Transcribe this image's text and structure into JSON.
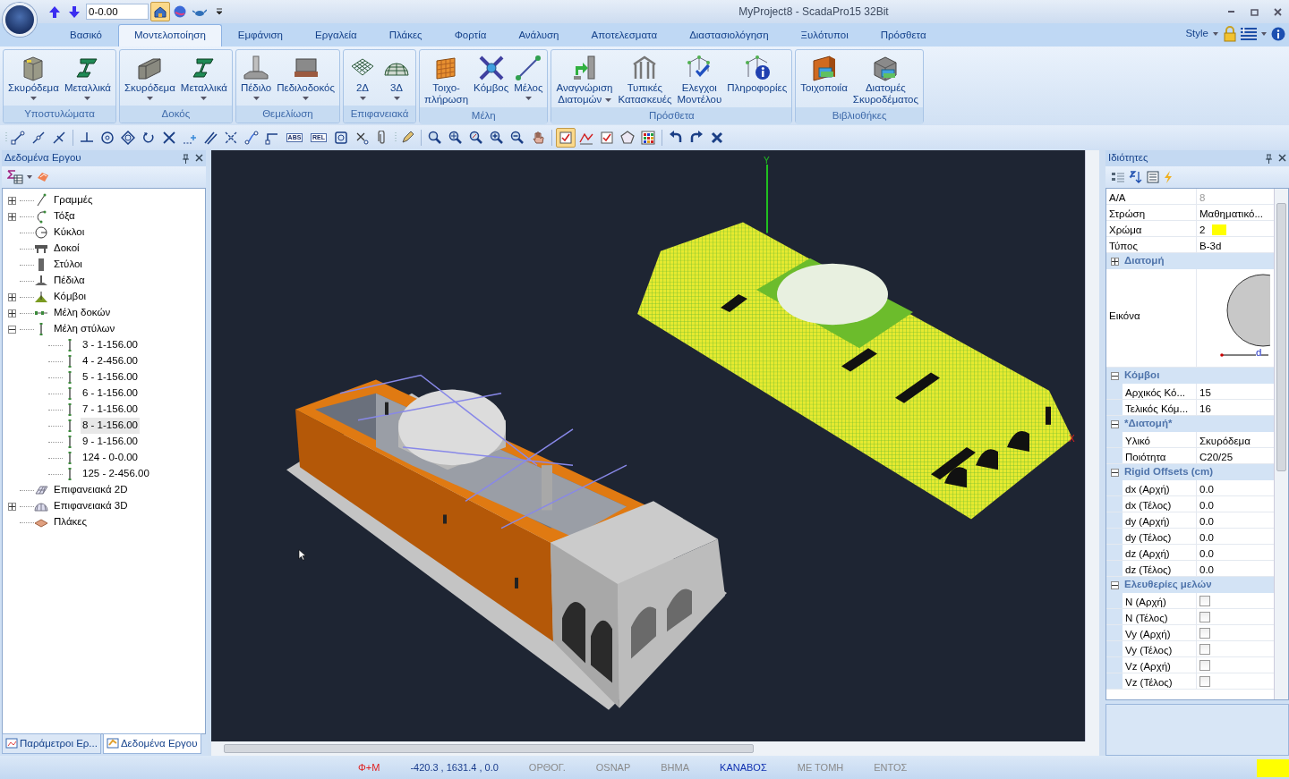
{
  "title_bar": {
    "title": "MyProject8 - ScadaPro15 32Bit",
    "level_value": "0-0.00",
    "quick_tools": [
      {
        "kind": "arrow-up",
        "pressed": false
      },
      {
        "kind": "arrow-down",
        "pressed": false
      },
      {
        "kind": "level"
      },
      {
        "kind": "house",
        "pressed": true
      },
      {
        "kind": "globe",
        "pressed": false
      },
      {
        "kind": "teapot",
        "pressed": false
      }
    ]
  },
  "ribbon": {
    "tabs": [
      {
        "label": "Βασικό",
        "selected": false
      },
      {
        "label": "Μοντελοποίηση",
        "selected": true
      },
      {
        "label": "Εμφάνιση",
        "selected": false
      },
      {
        "label": "Εργαλεία",
        "selected": false
      },
      {
        "label": "Πλάκες",
        "selected": false
      },
      {
        "label": "Φορτία",
        "selected": false
      },
      {
        "label": "Ανάλυση",
        "selected": false
      },
      {
        "label": "Αποτελεσματα",
        "selected": false
      },
      {
        "label": "Διαστασιολόγηση",
        "selected": false
      },
      {
        "label": "Ξυλότυποι",
        "selected": false
      },
      {
        "label": "Πρόσθετα",
        "selected": false
      }
    ],
    "style_label": "Style",
    "groups": [
      {
        "label": "Υποστυλώματα",
        "buttons": [
          {
            "kind": "concrete-column",
            "lines": [
              "Σκυρόδεμα"
            ],
            "dropdown": true
          },
          {
            "kind": "steel-section",
            "lines": [
              "Μεταλλικά"
            ],
            "dropdown": true
          }
        ]
      },
      {
        "label": "Δοκός",
        "buttons": [
          {
            "kind": "concrete-beam",
            "lines": [
              "Σκυρόδεμα"
            ],
            "dropdown": true
          },
          {
            "kind": "steel-section",
            "lines": [
              "Μεταλλικά"
            ],
            "dropdown": true
          }
        ]
      },
      {
        "label": "Θεμελίωση",
        "buttons": [
          {
            "kind": "footing",
            "lines": [
              "Πέδιλο"
            ],
            "dropdown": true
          },
          {
            "kind": "strip-footing",
            "lines": [
              "Πεδιλοδοκός"
            ],
            "dropdown": true
          }
        ]
      },
      {
        "label": "Επιφανειακά",
        "buttons": [
          {
            "kind": "mesh-2d",
            "lines": [
              "2Δ"
            ],
            "dropdown": true
          },
          {
            "kind": "mesh-3d",
            "lines": [
              "3Δ"
            ],
            "dropdown": true
          }
        ]
      },
      {
        "label": "Μέλη",
        "buttons": [
          {
            "kind": "infill-wall",
            "lines": [
              "Τοιχο-",
              "πλήρωση"
            ],
            "dropdown": false
          },
          {
            "kind": "node",
            "lines": [
              "Κόμβος"
            ],
            "dropdown": false
          },
          {
            "kind": "member",
            "lines": [
              "Μέλος"
            ],
            "dropdown": true
          }
        ]
      },
      {
        "label": "Πρόσθετα",
        "buttons": [
          {
            "kind": "section-detect",
            "lines": [
              "Αναγνώριση",
              "Διατομών"
            ],
            "dropdown": true
          },
          {
            "kind": "frame",
            "lines": [
              "Τυπικές",
              "Κατασκευές"
            ],
            "dropdown": false
          },
          {
            "kind": "model-check",
            "lines": [
              "Ελεγχοι",
              "Μοντέλου"
            ],
            "dropdown": false
          },
          {
            "kind": "model-info",
            "lines": [
              "Πληροφορίες"
            ],
            "dropdown": false
          }
        ]
      },
      {
        "label": "Βιβλιοθήκες",
        "buttons": [
          {
            "kind": "masonry",
            "lines": [
              "Τοιχοποιία"
            ],
            "dropdown": false
          },
          {
            "kind": "section-library",
            "lines": [
              "Διατομές",
              "Σκυροδέματος"
            ],
            "dropdown": false
          }
        ]
      }
    ]
  },
  "toolbar": [
    {
      "kind": "grip"
    },
    {
      "kind": "line2"
    },
    {
      "kind": "line1"
    },
    {
      "kind": "line3"
    },
    {
      "kind": "sep"
    },
    {
      "kind": "perp"
    },
    {
      "kind": "target"
    },
    {
      "kind": "diamond"
    },
    {
      "kind": "rotate"
    },
    {
      "kind": "cross"
    },
    {
      "kind": "dashplus"
    },
    {
      "kind": "parallel"
    },
    {
      "kind": "crossdots"
    },
    {
      "kind": "elbow"
    },
    {
      "kind": "corner"
    },
    {
      "kind": "text",
      "text": "ABS",
      "pressed": false
    },
    {
      "kind": "text",
      "text": "REL",
      "pressed": false
    },
    {
      "kind": "square"
    },
    {
      "kind": "xsmall"
    },
    {
      "kind": "clip"
    },
    {
      "kind": "grip"
    },
    {
      "kind": "pencil"
    },
    {
      "kind": "sep"
    },
    {
      "kind": "zoom"
    },
    {
      "kind": "zoomall"
    },
    {
      "kind": "zoomprev"
    },
    {
      "kind": "zoomin"
    },
    {
      "kind": "zoomout"
    },
    {
      "kind": "pan"
    },
    {
      "kind": "sep"
    },
    {
      "kind": "checkbox",
      "pressed": true
    },
    {
      "kind": "checkline",
      "pressed": false
    },
    {
      "kind": "checkbox",
      "pressed": false
    },
    {
      "kind": "pentagon",
      "pressed": false
    },
    {
      "kind": "colorgrid",
      "pressed": false
    },
    {
      "kind": "sep"
    },
    {
      "kind": "undo"
    },
    {
      "kind": "redo"
    },
    {
      "kind": "delete"
    }
  ],
  "project_panel": {
    "title": "Δεδομένα Εργου",
    "tree": [
      {
        "label": "Γραμμές",
        "kind": "line",
        "expandable": true,
        "expanded": false,
        "selected": false
      },
      {
        "label": "Τόξα",
        "kind": "arc",
        "expandable": true,
        "expanded": false,
        "selected": false
      },
      {
        "label": "Κύκλοι",
        "kind": "circle",
        "expandable": false,
        "selected": false
      },
      {
        "label": "Δοκοί",
        "kind": "beam",
        "expandable": false,
        "selected": false
      },
      {
        "label": "Στύλοι",
        "kind": "column",
        "expandable": false,
        "selected": false
      },
      {
        "label": "Πέδιλα",
        "kind": "footing",
        "expandable": false,
        "selected": false
      },
      {
        "label": "Κόμβοι",
        "kind": "node",
        "expandable": true,
        "expanded": false,
        "selected": false
      },
      {
        "label": "Μέλη δοκών",
        "kind": "beam-member",
        "expandable": true,
        "expanded": false,
        "selected": false
      },
      {
        "label": "Μέλη στύλων",
        "kind": "column-member",
        "expandable": true,
        "expanded": true,
        "selected": false,
        "children": [
          {
            "label": "3 - 1-156.00",
            "kind": "column-member",
            "expandable": false,
            "selected": false
          },
          {
            "label": "4 - 2-456.00",
            "kind": "column-member",
            "expandable": false,
            "selected": false
          },
          {
            "label": "5 - 1-156.00",
            "kind": "column-member",
            "expandable": false,
            "selected": false
          },
          {
            "label": "6 - 1-156.00",
            "kind": "column-member",
            "expandable": false,
            "selected": false
          },
          {
            "label": "7 - 1-156.00",
            "kind": "column-member",
            "expandable": false,
            "selected": false
          },
          {
            "label": "8 - 1-156.00",
            "kind": "column-member",
            "expandable": false,
            "selected": true
          },
          {
            "label": "9 - 1-156.00",
            "kind": "column-member",
            "expandable": false,
            "selected": false
          },
          {
            "label": "124 - 0-0.00",
            "kind": "column-member",
            "expandable": false,
            "selected": false
          },
          {
            "label": "125 - 2-456.00",
            "kind": "column-member",
            "expandable": false,
            "selected": false
          }
        ]
      },
      {
        "label": "Επιφανειακά 2D",
        "kind": "surface2d",
        "expandable": false,
        "selected": false
      },
      {
        "label": "Επιφανειακά 3D",
        "kind": "surface3d",
        "expandable": true,
        "expanded": false,
        "selected": false
      },
      {
        "label": "Πλάκες",
        "kind": "slab",
        "expandable": false,
        "selected": false
      }
    ],
    "bottom_tabs": [
      {
        "label": "Παράμετροι Ερ...",
        "selected": false
      },
      {
        "label": "Δεδομένα Εργου",
        "selected": true
      }
    ]
  },
  "viewport": {
    "axis_labels": [
      "Y",
      "X"
    ]
  },
  "properties_panel": {
    "title": "Ιδιότητες",
    "items": [
      {
        "kind": "row",
        "label": "A/A",
        "value": "8",
        "readonly": true
      },
      {
        "kind": "row",
        "label": "Στρώση",
        "value": "Μαθηματικό...",
        "readonly": false
      },
      {
        "kind": "color",
        "label": "Χρώμα",
        "value": "2",
        "color": "#ffff00"
      },
      {
        "kind": "row",
        "label": "Τύπος",
        "value": "B-3d",
        "readonly": false
      },
      {
        "kind": "category",
        "label": "Διατομή",
        "expanded": false
      },
      {
        "kind": "image",
        "label": "Εικόνα",
        "dim_label": "d"
      },
      {
        "kind": "category",
        "label": "Κόμβοι",
        "expanded": true,
        "children": [
          {
            "kind": "row",
            "label": "Αρχικός Κό...",
            "value": "15",
            "readonly": false
          },
          {
            "kind": "row",
            "label": "Τελικός Κόμ...",
            "value": "16",
            "readonly": false
          }
        ]
      },
      {
        "kind": "category",
        "label": "*Διατομή*",
        "expanded": true,
        "children": [
          {
            "kind": "row",
            "label": "Υλικό",
            "value": "Σκυρόδεμα",
            "readonly": false
          },
          {
            "kind": "row",
            "label": "Ποιότητα",
            "value": "C20/25",
            "readonly": false
          }
        ]
      },
      {
        "kind": "category",
        "label": "Rigid Offsets (cm)",
        "expanded": true,
        "children": [
          {
            "kind": "row",
            "label": "dx (Αρχή)",
            "value": "0.0",
            "readonly": false
          },
          {
            "kind": "row",
            "label": "dx (Τέλος)",
            "value": "0.0",
            "readonly": false
          },
          {
            "kind": "row",
            "label": "dy (Αρχή)",
            "value": "0.0",
            "readonly": false
          },
          {
            "kind": "row",
            "label": "dy (Τέλος)",
            "value": "0.0",
            "readonly": false
          },
          {
            "kind": "row",
            "label": "dz (Αρχή)",
            "value": "0.0",
            "readonly": false
          },
          {
            "kind": "row",
            "label": "dz (Τέλος)",
            "value": "0.0",
            "readonly": false
          }
        ]
      },
      {
        "kind": "category",
        "label": "Ελευθερίες μελών",
        "expanded": true,
        "children": [
          {
            "kind": "check",
            "label": "N (Αρχή)",
            "checked": false
          },
          {
            "kind": "check",
            "label": "N (Τέλος)",
            "checked": false
          },
          {
            "kind": "check",
            "label": "Vy (Αρχή)",
            "checked": false
          },
          {
            "kind": "check",
            "label": "Vy (Τέλος)",
            "checked": false
          },
          {
            "kind": "check",
            "label": "Vz (Αρχή)",
            "checked": false
          },
          {
            "kind": "check",
            "label": "Vz (Τέλος)",
            "checked": false
          }
        ]
      }
    ]
  },
  "status_bar": [
    {
      "text": "Φ+Μ",
      "color": "#e02020"
    },
    {
      "text": "-420.3 , 1631.4 , 0.0",
      "color": "#1a3c8c"
    },
    {
      "text": "ΟΡΘΟΓ.",
      "color": "#8a8a8a"
    },
    {
      "text": "OSNAP",
      "color": "#8a8a8a"
    },
    {
      "text": "ΒΗΜΑ",
      "color": "#8a8a8a"
    },
    {
      "text": "ΚΑΝΑΒΟΣ",
      "color": "#1030b0"
    },
    {
      "text": "ΜΕ ΤΟΜΗ",
      "color": "#8a8a8a"
    },
    {
      "text": "ΕΝΤΟΣ",
      "color": "#8a8a8a"
    }
  ]
}
